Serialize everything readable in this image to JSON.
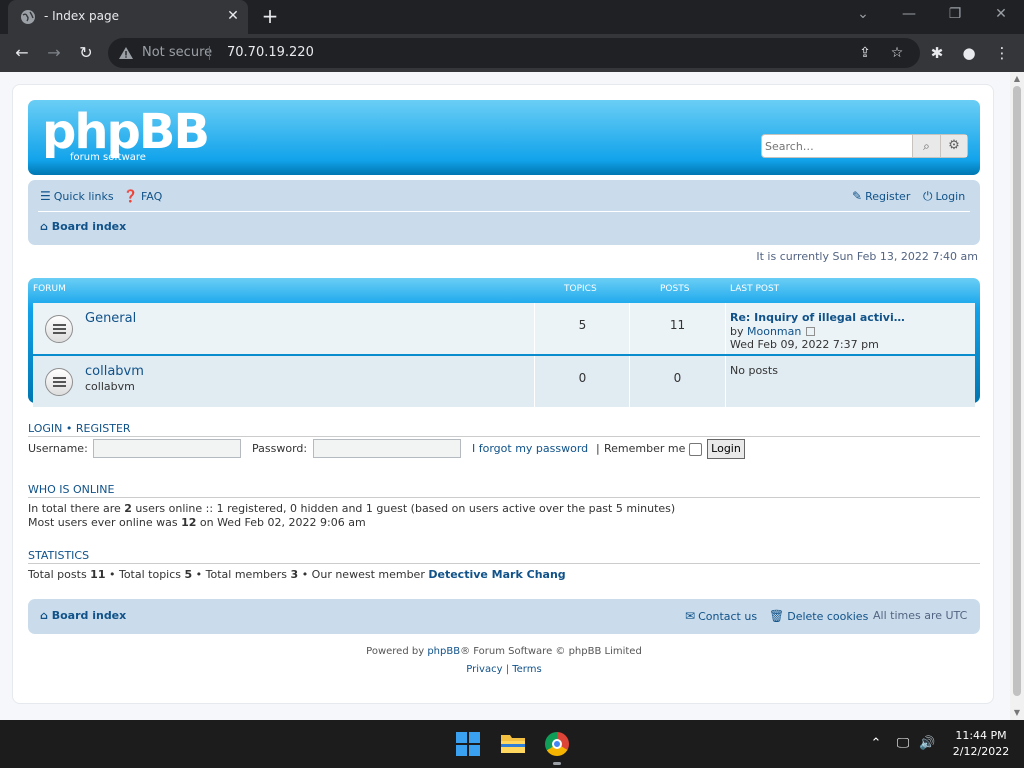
{
  "browser": {
    "tab_title": "- Index page",
    "tab_close": "✕",
    "new_tab": "+",
    "secure_label": "Not secure",
    "url": "70.70.19.220"
  },
  "header": {
    "logo_main": "phpBB",
    "logo_sub": "forum  software",
    "search_placeholder": "Search…"
  },
  "navbar": {
    "quick_links": "Quick links",
    "faq": "FAQ",
    "register": "Register",
    "login": "Login",
    "board_index": "Board index"
  },
  "current_time": "It is currently Sun Feb 13, 2022 7:40 am",
  "forum_table": {
    "headers": {
      "forum": "Forum",
      "topics": "Topics",
      "posts": "Posts",
      "last_post": "Last post"
    },
    "rows": [
      {
        "name": "General",
        "description": "",
        "topics": "5",
        "posts": "11",
        "last_post_title": "Re: Inquiry of illegal activi…",
        "last_post_by_prefix": "by",
        "last_post_author": "Moonman",
        "last_post_date": "Wed Feb 09, 2022 7:37 pm"
      },
      {
        "name": "collabvm",
        "description": "collabvm",
        "topics": "0",
        "posts": "0",
        "last_post_title": "No posts"
      }
    ]
  },
  "login_section": {
    "heading_login": "Login",
    "heading_sep": "•",
    "heading_register": "Register",
    "username_label": "Username:",
    "password_label": "Password:",
    "forgot": "I forgot my password",
    "remember": "Remember me",
    "login_button": "Login",
    "pipe": "|"
  },
  "who_is_online": {
    "heading": "Who is online",
    "line1_a": "In total there are ",
    "line1_count": "2",
    "line1_b": " users online :: 1 registered, 0 hidden and 1 guest (based on users active over the past 5 minutes)",
    "line2_a": "Most users ever online was ",
    "line2_count": "12",
    "line2_b": " on Wed Feb 02, 2022 9:06 am"
  },
  "statistics": {
    "heading": "Statistics",
    "total_posts_label": "Total posts ",
    "total_posts": "11",
    "total_topics_label": " • Total topics ",
    "total_topics": "5",
    "total_members_label": " • Total members ",
    "total_members": "3",
    "newest_label": " • Our newest member ",
    "newest_member": "Detective Mark Chang"
  },
  "footer_nav": {
    "board_index": "Board index",
    "contact": "Contact us",
    "delete_cookies": "Delete cookies",
    "timezone": "All times are UTC"
  },
  "copyright": {
    "powered_prefix": "Powered by ",
    "phpbb": "phpBB",
    "powered_suffix": "® Forum Software © phpBB Limited",
    "privacy": "Privacy",
    "sep": " | ",
    "terms": "Terms"
  },
  "taskbar": {
    "time": "11:44 PM",
    "date": "2/12/2022"
  },
  "colors": {
    "link": "#105289",
    "header_blue": "#12a3eb",
    "nav_bg": "#cadceb"
  }
}
